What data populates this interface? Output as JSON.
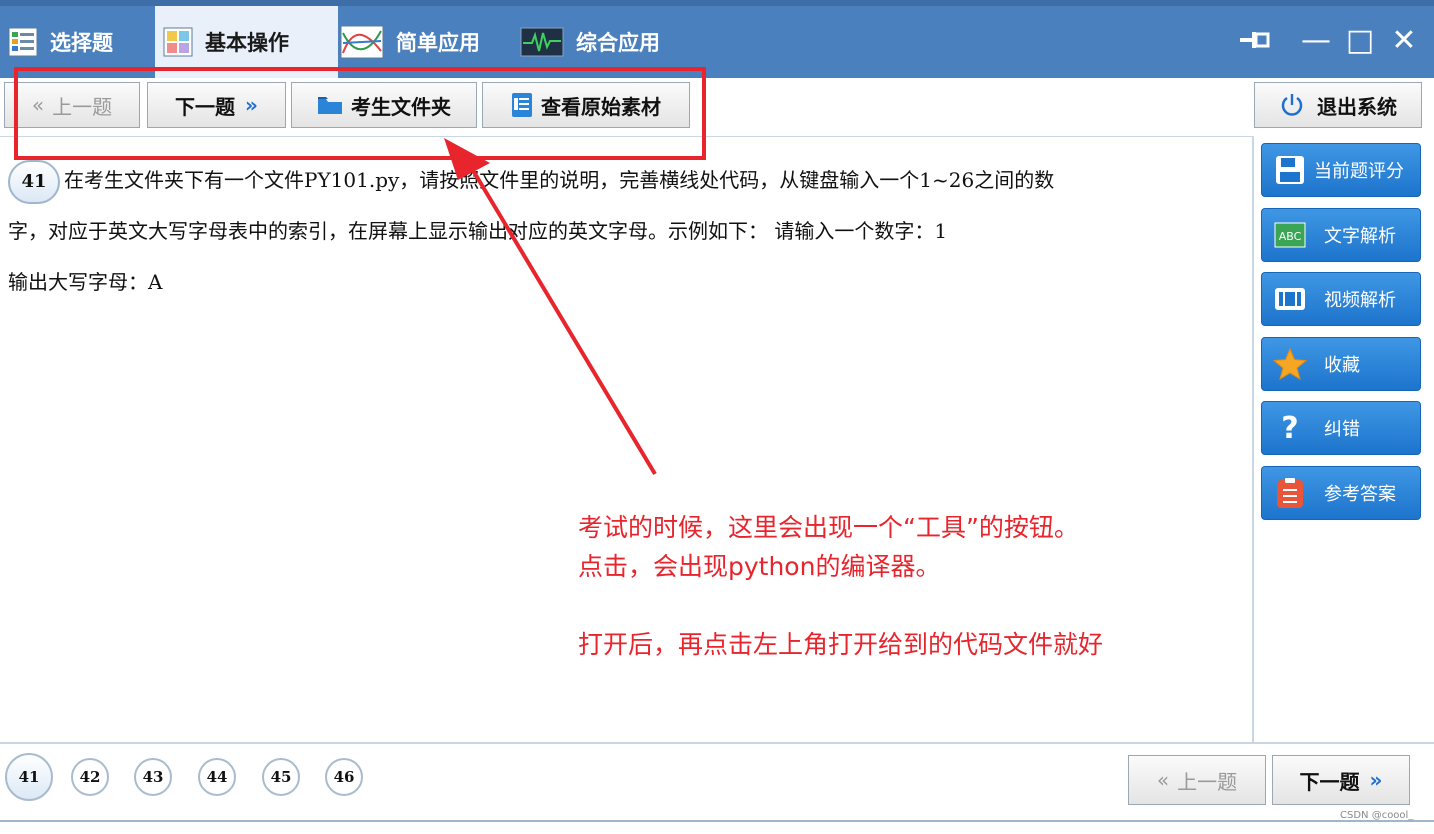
{
  "window": {
    "tabs": [
      {
        "label": "选择题",
        "icon": "list-icon",
        "active": false
      },
      {
        "label": "基本操作",
        "icon": "grid-icon",
        "active": true
      },
      {
        "label": "简单应用",
        "icon": "chart-icon",
        "active": false
      },
      {
        "label": "综合应用",
        "icon": "waveform-icon",
        "active": false
      }
    ],
    "controls": {
      "pin": "pin-icon",
      "minimize": "—",
      "maximize": "□",
      "close": "✕"
    }
  },
  "toolbar": {
    "prev_label": "上一题",
    "next_label": "下一题",
    "folder_label": "考生文件夹",
    "material_label": "查看原始素材",
    "exit_label": "退出系统"
  },
  "question": {
    "number": "41",
    "line1": "在考生文件夹下有一个文件PY101.py，请按照文件里的说明，完善横线处代码，从键盘输入一个1~26之间的数",
    "line2": "字，对应于英文大写字母表中的索引，在屏幕上显示输出对应的英文字母。示例如下： 请输入一个数字：1",
    "line3": "输出大写字母：A"
  },
  "sidebar": {
    "buttons": [
      {
        "label": "当前题评分",
        "icon": "save-icon"
      },
      {
        "label": "文字解析",
        "icon": "text-abc-icon"
      },
      {
        "label": "视频解析",
        "icon": "film-icon"
      },
      {
        "label": "收藏",
        "icon": "star-icon"
      },
      {
        "label": "纠错",
        "icon": "question-icon"
      },
      {
        "label": "参考答案",
        "icon": "clipboard-icon"
      }
    ]
  },
  "navigation": {
    "numbers": [
      "41",
      "42",
      "43",
      "44",
      "45",
      "46"
    ],
    "current": "41",
    "prev_label": "上一题",
    "next_label": "下一题"
  },
  "annotation": {
    "line1": "考试的时候，这里会出现一个“工具”的按钮。",
    "line2": "点击，会出现python的编译器。",
    "line3": "打开后，再点击左上角打开给到的代码文件就好",
    "color": "#e8242d"
  },
  "watermark": "CSDN @coool_",
  "colors": {
    "titlebar": "#4a80bd",
    "sidebar_button": "#2a84d8",
    "annotation": "#e8242d"
  }
}
